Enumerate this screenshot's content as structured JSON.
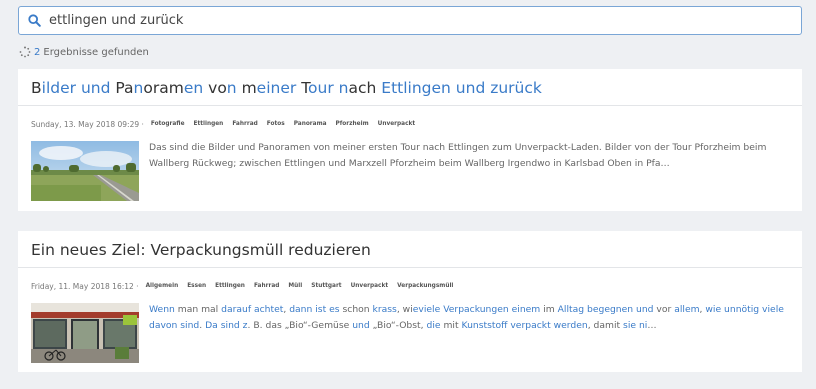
{
  "search": {
    "value": "ettlingen und zurück",
    "icon": "search-icon"
  },
  "results": {
    "count": "2",
    "label": "Ergebnisse gefunden",
    "icon": "spinner-icon"
  },
  "colors": {
    "accent": "#3a7bc8",
    "background": "#eef0f3",
    "card": "#ffffff"
  },
  "items": [
    {
      "title_segments": [
        {
          "t": "B",
          "h": false
        },
        {
          "t": "ilder",
          "h": true
        },
        {
          "t": " ",
          "h": false
        },
        {
          "t": "und",
          "h": true
        },
        {
          "t": " ",
          "h": false
        },
        {
          "t": "Pa",
          "h": false
        },
        {
          "t": "n",
          "h": true
        },
        {
          "t": "oram",
          "h": false
        },
        {
          "t": "en",
          "h": true
        },
        {
          "t": " ",
          "h": false
        },
        {
          "t": "vo",
          "h": false
        },
        {
          "t": "n",
          "h": true
        },
        {
          "t": " ",
          "h": false
        },
        {
          "t": "m",
          "h": false
        },
        {
          "t": "einer",
          "h": true
        },
        {
          "t": " ",
          "h": false
        },
        {
          "t": "T",
          "h": false
        },
        {
          "t": "our",
          "h": true
        },
        {
          "t": " ",
          "h": false
        },
        {
          "t": "n",
          "h": true
        },
        {
          "t": "ach",
          "h": false
        },
        {
          "t": " ",
          "h": false
        },
        {
          "t": "Ettlingen und zurück",
          "h": true
        }
      ],
      "date": "Sunday, 13. May 2018 09:29 ·",
      "tags": [
        "Fotografie",
        "Ettlingen",
        "Fahrrad",
        "Fotos",
        "Panorama",
        "Pforzheim",
        "Unverpackt"
      ],
      "thumbnail": "road-landscape-image",
      "excerpt_segments": [
        {
          "t": "Das sind die Bilder und Panoramen von meiner ersten Tour nach Ettlingen zum Unverpackt-Laden. Bilder von der Tour Pforzheim beim Wallberg Rückweg; zwischen Ettlingen und Marxzell Pforzheim beim Wallberg Irgendwo in Karlsbad Oben in Pfa…",
          "h": false
        }
      ]
    },
    {
      "title_segments": [
        {
          "t": "Ein neues Ziel: Verpackungsmüll reduzieren",
          "h": false
        }
      ],
      "date": "Friday, 11. May 2018 16:12 ·",
      "tags": [
        "Allgemein",
        "Essen",
        "Ettlingen",
        "Fahrrad",
        "Müll",
        "Stuttgart",
        "Unverpackt",
        "Verpackungsmüll"
      ],
      "thumbnail": "shop-front-image",
      "excerpt_segments": [
        {
          "t": "Wenn",
          "h": true
        },
        {
          "t": " man mal ",
          "h": false
        },
        {
          "t": "darauf",
          "h": true
        },
        {
          "t": " ",
          "h": false
        },
        {
          "t": "achtet",
          "h": true
        },
        {
          "t": ", ",
          "h": false
        },
        {
          "t": "dann",
          "h": true
        },
        {
          "t": " ",
          "h": false
        },
        {
          "t": "ist",
          "h": true
        },
        {
          "t": " ",
          "h": false
        },
        {
          "t": "es",
          "h": true
        },
        {
          "t": " schon ",
          "h": false
        },
        {
          "t": "krass",
          "h": true
        },
        {
          "t": ", wi",
          "h": false
        },
        {
          "t": "eviele",
          "h": true
        },
        {
          "t": " ",
          "h": false
        },
        {
          "t": "Verpackungen",
          "h": true
        },
        {
          "t": " ",
          "h": false
        },
        {
          "t": "einem",
          "h": true
        },
        {
          "t": " im ",
          "h": false
        },
        {
          "t": "Alltag",
          "h": true
        },
        {
          "t": " ",
          "h": false
        },
        {
          "t": "begegnen",
          "h": true
        },
        {
          "t": " ",
          "h": false
        },
        {
          "t": "und",
          "h": true
        },
        {
          "t": " vor ",
          "h": false
        },
        {
          "t": "allem",
          "h": true
        },
        {
          "t": ", ",
          "h": false
        },
        {
          "t": "wie",
          "h": true
        },
        {
          "t": " ",
          "h": false
        },
        {
          "t": "unnötig",
          "h": true
        },
        {
          "t": " ",
          "h": false
        },
        {
          "t": "viele",
          "h": true
        },
        {
          "t": " ",
          "h": false
        },
        {
          "t": "davon",
          "h": true
        },
        {
          "t": " ",
          "h": false
        },
        {
          "t": "sind",
          "h": true
        },
        {
          "t": ". ",
          "h": false
        },
        {
          "t": "Da",
          "h": true
        },
        {
          "t": " ",
          "h": false
        },
        {
          "t": "sind",
          "h": true
        },
        {
          "t": " ",
          "h": false
        },
        {
          "t": "z",
          "h": true
        },
        {
          "t": ". B. das „Bio“-Gemüse ",
          "h": false
        },
        {
          "t": "und",
          "h": true
        },
        {
          "t": " „Bio“-Obst, ",
          "h": false
        },
        {
          "t": "die",
          "h": true
        },
        {
          "t": " mit ",
          "h": false
        },
        {
          "t": "Kunststoff",
          "h": true
        },
        {
          "t": " ",
          "h": false
        },
        {
          "t": "verpackt",
          "h": true
        },
        {
          "t": " ",
          "h": false
        },
        {
          "t": "werden",
          "h": true
        },
        {
          "t": ", damit ",
          "h": false
        },
        {
          "t": "sie",
          "h": true
        },
        {
          "t": " ",
          "h": false
        },
        {
          "t": "ni",
          "h": true
        },
        {
          "t": "…",
          "h": false
        }
      ]
    }
  ]
}
